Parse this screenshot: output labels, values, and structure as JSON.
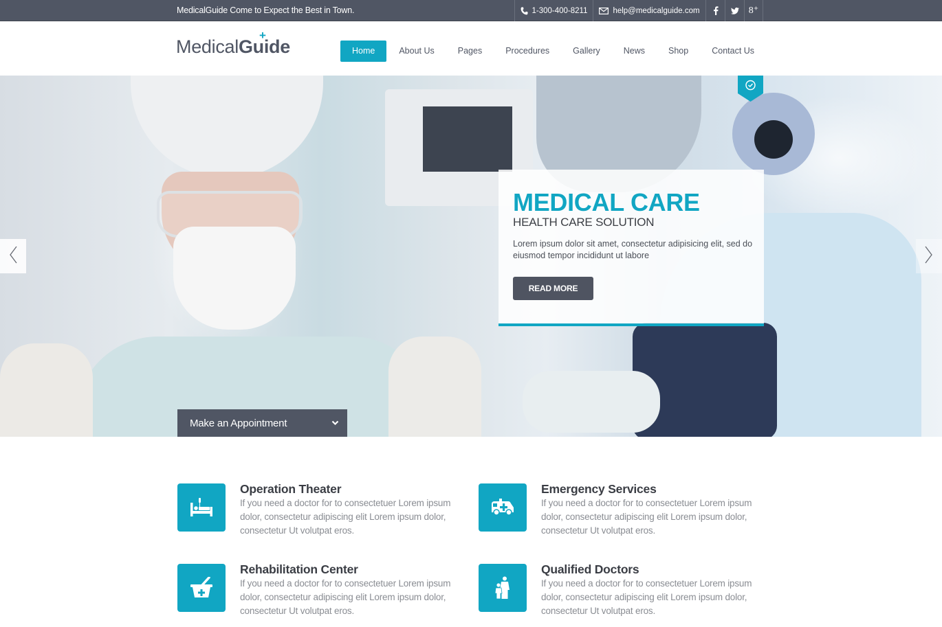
{
  "topbar": {
    "tagline": "MedicalGuide Come to Expect the Best in Town.",
    "phone": "1-300-400-8211",
    "email": "help@medicalguide.com",
    "social": [
      {
        "name": "facebook",
        "glyph": "f"
      },
      {
        "name": "twitter",
        "glyph": "t"
      },
      {
        "name": "google-plus",
        "glyph": "8⁺"
      }
    ]
  },
  "logo": {
    "light": "Medical",
    "bold": "Guide",
    "accent": "+"
  },
  "nav": {
    "items": [
      {
        "label": "Home",
        "active": true
      },
      {
        "label": "About Us"
      },
      {
        "label": "Pages"
      },
      {
        "label": "Procedures"
      },
      {
        "label": "Gallery"
      },
      {
        "label": "News"
      },
      {
        "label": "Shop"
      },
      {
        "label": "Contact Us"
      }
    ]
  },
  "hero": {
    "title": "MEDICAL CARE",
    "subtitle": "HEALTH CARE SOLUTION",
    "description": "Lorem ipsum dolor sit amet, consectetur adipisicing elit, sed do eiusmod tempor incididunt ut labore",
    "cta": "READ MORE",
    "appointment_label": "Make an Appointment",
    "icons": {
      "prev": "chevron-left-icon",
      "next": "chevron-right-icon",
      "pin": "clock-icon",
      "dropdown": "chevron-down-icon"
    }
  },
  "services": [
    {
      "title": "Operation Theater",
      "icon": "hospital-bed-icon",
      "description": "If you need a doctor for to consectetuer Lorem ipsum dolor, consectetur adipiscing elit Lorem ipsum dolor, consectetur Ut volutpat eros."
    },
    {
      "title": "Emergency Services",
      "icon": "ambulance-icon",
      "description": "If you need a doctor for to consectetuer Lorem ipsum dolor, consectetur adipiscing elit Lorem ipsum dolor, consectetur Ut volutpat eros."
    },
    {
      "title": "Rehabilitation Center",
      "icon": "medical-basket-icon",
      "description": "If you need a doctor for to consectetuer Lorem ipsum dolor, consectetur adipiscing elit Lorem ipsum dolor, consectetur Ut volutpat eros."
    },
    {
      "title": "Qualified Doctors",
      "icon": "doctors-icon",
      "description": "If you need a doctor for to consectetuer Lorem ipsum dolor, consectetur adipiscing elit Lorem ipsum dolor, consectetur Ut volutpat eros."
    }
  ],
  "colors": {
    "accent": "#11a6c3",
    "dark": "#505664",
    "text": "#3a3d44",
    "muted": "#8a8d93"
  }
}
